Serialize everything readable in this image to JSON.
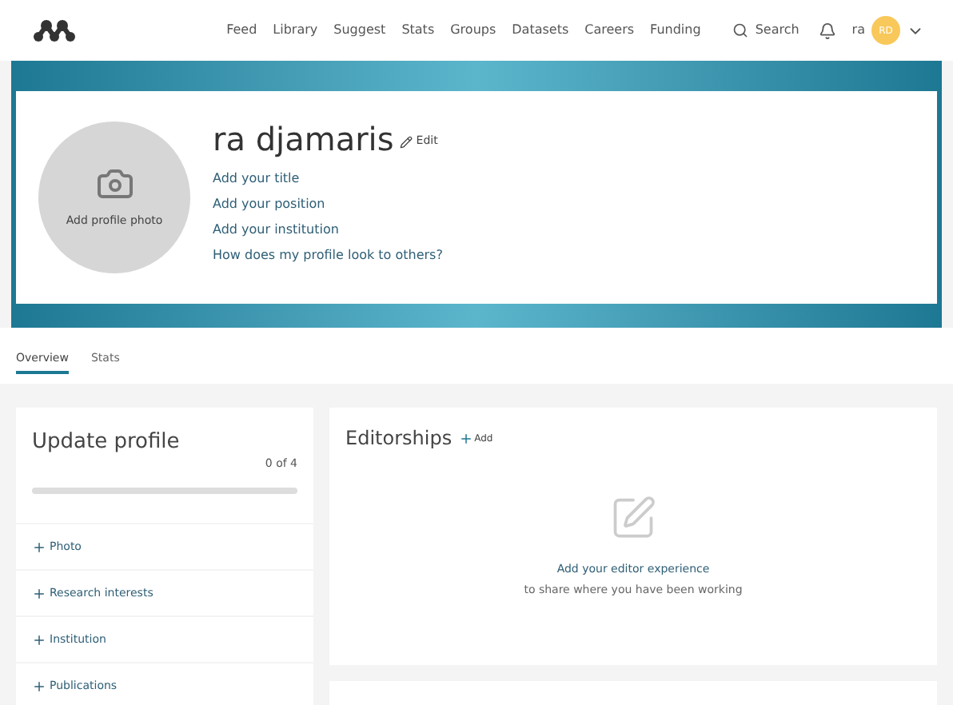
{
  "nav": {
    "links": [
      "Feed",
      "Library",
      "Suggest",
      "Stats",
      "Groups",
      "Datasets",
      "Careers",
      "Funding"
    ],
    "search": "Search",
    "user": "ra",
    "avatar": "RD"
  },
  "profile": {
    "photo_label": "Add profile photo",
    "name": "ra djamaris",
    "edit": "Edit",
    "links": [
      "Add your title",
      "Add your position",
      "Add your institution",
      "How does my profile look to others?"
    ]
  },
  "tabs": [
    {
      "label": "Overview",
      "selected": true
    },
    {
      "label": "Stats",
      "selected": false
    }
  ],
  "update_profile": {
    "title": "Update profile",
    "count": "0 of 4",
    "level": 0,
    "items": [
      "Photo",
      "Research interests",
      "Institution",
      "Publications"
    ]
  },
  "editorships": {
    "title": "Editorships",
    "add": "Add",
    "empty_link": "Add your editor experience",
    "empty_text": "to share where you have been working"
  }
}
